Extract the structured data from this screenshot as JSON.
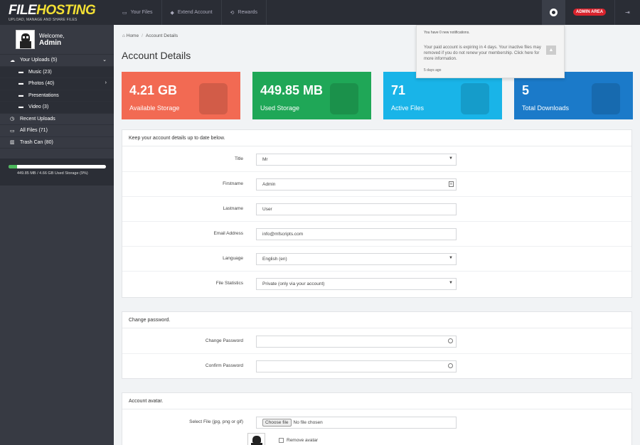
{
  "logo": {
    "line1_a": "FILE",
    "line1_b": "HOSTING",
    "tagline": "UPLOAD, MANAGE AND SHARE FILES"
  },
  "topnav": [
    {
      "label": "Your Files",
      "icon": "drive-icon"
    },
    {
      "label": "Extend Account",
      "icon": "tag-icon"
    },
    {
      "label": "Rewards",
      "icon": "rewards-icon"
    }
  ],
  "admin_badge": "ADMIN AREA",
  "notifications": {
    "header": "You have 0 new notifications.",
    "message": "Your paid account is expiring in 4 days. Your inactive files may removed if you do not renew your membership. Click here for more information.",
    "time": "5 days ago"
  },
  "sidebar": {
    "welcome": "Welcome,",
    "username": "Admin",
    "items": [
      {
        "label": "Your Uploads (5)",
        "icon": "cloud-upload-icon",
        "sub": false,
        "chevron": "⌄"
      },
      {
        "label": "Music (23)",
        "icon": "folder-icon",
        "sub": true,
        "chevron": ""
      },
      {
        "label": "Photos (40)",
        "icon": "folder-icon",
        "sub": true,
        "chevron": "›"
      },
      {
        "label": "Presentations",
        "icon": "folder-icon",
        "sub": true,
        "chevron": ""
      },
      {
        "label": "Video (3)",
        "icon": "folder-icon",
        "sub": true,
        "chevron": ""
      },
      {
        "label": "Recent Uploads",
        "icon": "clock-icon",
        "sub": false,
        "chevron": ""
      },
      {
        "label": "All Files (71)",
        "icon": "drive-icon",
        "sub": false,
        "chevron": ""
      },
      {
        "label": "Trash Can (80)",
        "icon": "trash-icon",
        "sub": false,
        "chevron": ""
      }
    ],
    "storage_text": "449.85 MB / 4.66 GB Used Storage (9%)",
    "storage_fraction": 0.09
  },
  "breadcrumb": {
    "home": "Home",
    "current": "Account Details"
  },
  "page_title": "Account Details",
  "stats": [
    {
      "value": "4.21 GB",
      "label": "Available Storage",
      "color": "#f26a53"
    },
    {
      "value": "449.85 MB",
      "label": "Used Storage",
      "color": "#1fa757"
    },
    {
      "value": "71",
      "label": "Active Files",
      "color": "#19b4e8"
    },
    {
      "value": "5",
      "label": "Total Downloads",
      "color": "#1b7ac9"
    }
  ],
  "account_panel": {
    "heading": "Keep your account details up to date below.",
    "fields": [
      {
        "label": "Title",
        "value": "Mr"
      },
      {
        "label": "Firstname",
        "value": "Admin"
      },
      {
        "label": "Lastname",
        "value": "User"
      },
      {
        "label": "Email Address",
        "value": "info@mfscripts.com"
      },
      {
        "label": "Language",
        "value": "English (en)"
      },
      {
        "label": "File Statistics",
        "value": "Private (only via your account)"
      }
    ]
  },
  "password_panel": {
    "heading": "Change password.",
    "fields": [
      {
        "label": "Change Password",
        "value": ""
      },
      {
        "label": "Confirm Password",
        "value": ""
      }
    ]
  },
  "avatar_panel": {
    "heading": "Account avatar.",
    "file_label": "Select File (jpg, png or gif)",
    "choose_button": "Choose file",
    "no_file": "No file chosen",
    "remove_label": "Remove avatar"
  }
}
